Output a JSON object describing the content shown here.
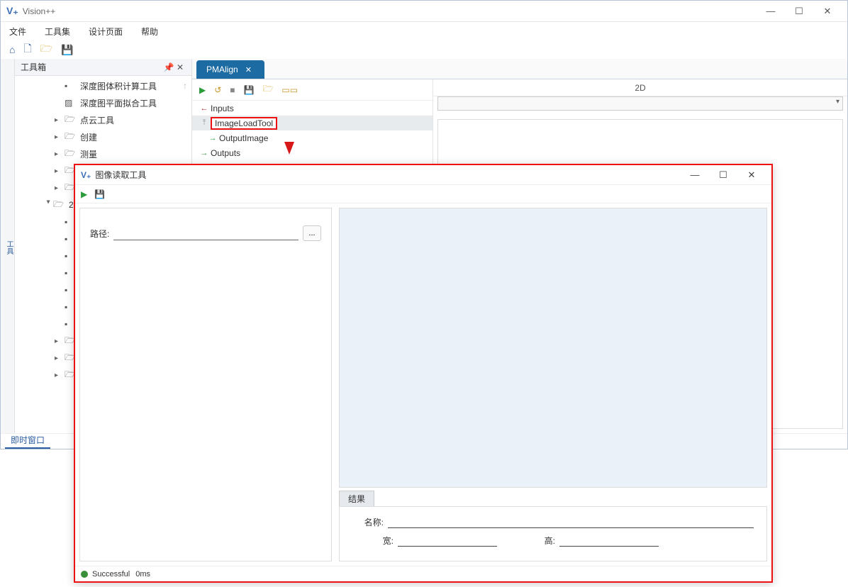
{
  "app": {
    "title": "Vision++"
  },
  "winbtns": {
    "min": "—",
    "max": "☐",
    "close": "✕"
  },
  "menu": {
    "file": "文件",
    "toolset": "工具集",
    "design": "设计页面",
    "help": "帮助"
  },
  "toolbox": {
    "header": "工具箱",
    "items": {
      "depthVolume": "深度图体积计算工具",
      "depthPlane": "深度图平面拟合工具",
      "pointcloud": "点云工具",
      "create": "创建",
      "measure": "测量",
      "two": "2"
    }
  },
  "leftRail": "工具",
  "tab": {
    "label": "PMAlign"
  },
  "viewport": {
    "header": "2D"
  },
  "nodes": {
    "inputs": "Inputs",
    "imageLoad": "ImageLoadTool",
    "outputImage": "OutputImage",
    "outputs": "Outputs"
  },
  "statusbar": {
    "immediate": "即时窗口"
  },
  "dialog": {
    "title": "图像读取工具",
    "pathLabel": "路径:",
    "browse": "...",
    "resultsTab": "结果",
    "nameLabel": "名称:",
    "widthLabel": "宽:",
    "heightLabel": "高:",
    "status": "Successful",
    "time": "0ms"
  }
}
